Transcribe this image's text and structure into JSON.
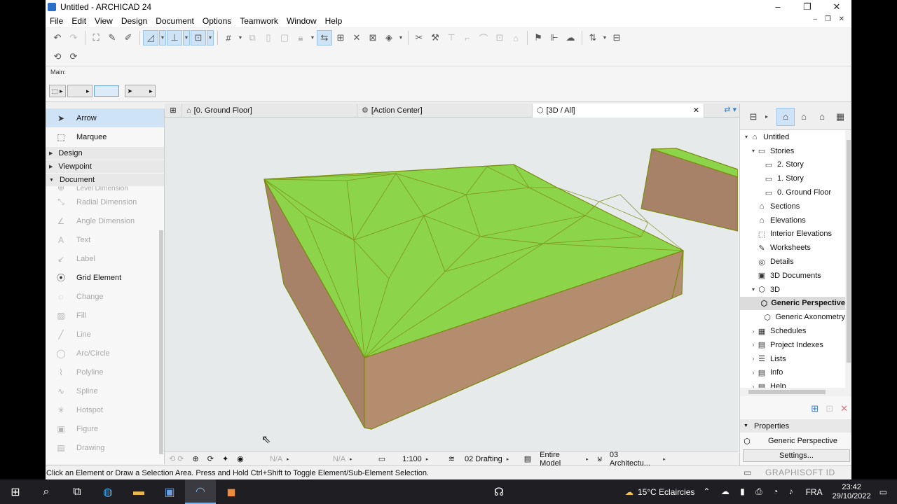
{
  "window": {
    "title": "Untitled - ARCHICAD 24",
    "controls": [
      "–",
      "❐",
      "✕"
    ]
  },
  "menu": [
    "File",
    "Edit",
    "View",
    "Design",
    "Document",
    "Options",
    "Teamwork",
    "Window",
    "Help"
  ],
  "infobox": {
    "label": "Main:"
  },
  "toolbox": {
    "arrow": "Arrow",
    "marquee": "Marquee",
    "groups": {
      "design": "Design",
      "viewpoint": "Viewpoint",
      "document": "Document"
    },
    "partial_item": "Level Dimension",
    "tools": [
      {
        "label": "Radial Dimension",
        "icon": "radial-dimension-icon",
        "glyph": "⤡",
        "enabled": false
      },
      {
        "label": "Angle Dimension",
        "icon": "angle-dimension-icon",
        "glyph": "∠",
        "enabled": false
      },
      {
        "label": "Text",
        "icon": "text-icon",
        "glyph": "A",
        "enabled": false
      },
      {
        "label": "Label",
        "icon": "label-icon",
        "glyph": "↙",
        "enabled": false
      },
      {
        "label": "Grid Element",
        "icon": "grid-element-icon",
        "glyph": "⦿",
        "enabled": true
      },
      {
        "label": "Change",
        "icon": "change-icon",
        "glyph": "◌",
        "enabled": false
      },
      {
        "label": "Fill",
        "icon": "fill-icon",
        "glyph": "▨",
        "enabled": false
      },
      {
        "label": "Line",
        "icon": "line-icon",
        "glyph": "╱",
        "enabled": false
      },
      {
        "label": "Arc/Circle",
        "icon": "arc-circle-icon",
        "glyph": "◯",
        "enabled": false
      },
      {
        "label": "Polyline",
        "icon": "polyline-icon",
        "glyph": "⌇",
        "enabled": false
      },
      {
        "label": "Spline",
        "icon": "spline-icon",
        "glyph": "∿",
        "enabled": false
      },
      {
        "label": "Hotspot",
        "icon": "hotspot-icon",
        "glyph": "✳",
        "enabled": false
      },
      {
        "label": "Figure",
        "icon": "figure-icon",
        "glyph": "▣",
        "enabled": false
      },
      {
        "label": "Drawing",
        "icon": "drawing-icon",
        "glyph": "▤",
        "enabled": false
      }
    ]
  },
  "tabs": [
    {
      "label": "[0. Ground Floor]",
      "icon": "floor-plan-icon",
      "glyph": "⌂"
    },
    {
      "label": "[Action Center]",
      "icon": "action-center-icon",
      "glyph": "⚙"
    },
    {
      "label": "[3D / All]",
      "icon": "3d-view-icon",
      "glyph": "⬡"
    }
  ],
  "view_status": {
    "nav_a": "N/A",
    "nav_b": "N/A",
    "scale": "1:100",
    "layer_combo": "02 Drafting",
    "model_view": "Entire Model",
    "renovation": "03 Architectu..."
  },
  "status_message": "Click an Element or Draw a Selection Area. Press and Hold Ctrl+Shift to Toggle Element/Sub-Element Selection.",
  "brand": "GRAPHISOFT ID",
  "navigator": {
    "items": [
      {
        "label": "Untitled",
        "indent": 0,
        "caret": "▾",
        "icon": "project-icon",
        "glyph": "⌂",
        "selected": false
      },
      {
        "label": "Stories",
        "indent": 1,
        "caret": "▾",
        "icon": "stories-icon",
        "glyph": "▭",
        "selected": false
      },
      {
        "label": "2. Story",
        "indent": 2,
        "caret": "",
        "icon": "story-icon",
        "glyph": "▭",
        "selected": false
      },
      {
        "label": "1. Story",
        "indent": 2,
        "caret": "",
        "icon": "story-icon",
        "glyph": "▭",
        "selected": false
      },
      {
        "label": "0. Ground Floor",
        "indent": 2,
        "caret": "",
        "icon": "story-icon",
        "glyph": "▭",
        "selected": false
      },
      {
        "label": "Sections",
        "indent": 1,
        "caret": "",
        "icon": "sections-icon",
        "glyph": "⌂",
        "selected": false
      },
      {
        "label": "Elevations",
        "indent": 1,
        "caret": "",
        "icon": "elevations-icon",
        "glyph": "⌂",
        "selected": false
      },
      {
        "label": "Interior Elevations",
        "indent": 1,
        "caret": "",
        "icon": "interior-elevations-icon",
        "glyph": "⬚",
        "selected": false
      },
      {
        "label": "Worksheets",
        "indent": 1,
        "caret": "",
        "icon": "worksheets-icon",
        "glyph": "✎",
        "selected": false
      },
      {
        "label": "Details",
        "indent": 1,
        "caret": "",
        "icon": "details-icon",
        "glyph": "◎",
        "selected": false
      },
      {
        "label": "3D Documents",
        "indent": 1,
        "caret": "",
        "icon": "3d-documents-icon",
        "glyph": "▣",
        "selected": false
      },
      {
        "label": "3D",
        "indent": 1,
        "caret": "▾",
        "icon": "3d-icon",
        "glyph": "⬡",
        "selected": false
      },
      {
        "label": "Generic Perspective",
        "indent": 2,
        "caret": "",
        "icon": "perspective-icon",
        "glyph": "⬡",
        "selected": true
      },
      {
        "label": "Generic Axonometry",
        "indent": 2,
        "caret": "",
        "icon": "axonometry-icon",
        "glyph": "⬡",
        "selected": false
      },
      {
        "label": "Schedules",
        "indent": 1,
        "caret": "›",
        "icon": "schedules-icon",
        "glyph": "▦",
        "selected": false
      },
      {
        "label": "Project Indexes",
        "indent": 1,
        "caret": "›",
        "icon": "project-indexes-icon",
        "glyph": "▤",
        "selected": false
      },
      {
        "label": "Lists",
        "indent": 1,
        "caret": "›",
        "icon": "lists-icon",
        "glyph": "☰",
        "selected": false
      },
      {
        "label": "Info",
        "indent": 1,
        "caret": "›",
        "icon": "info-icon",
        "glyph": "▤",
        "selected": false
      },
      {
        "label": "Help",
        "indent": 1,
        "caret": "›",
        "icon": "help-icon",
        "glyph": "▤",
        "selected": false
      }
    ],
    "properties_header": "Properties",
    "properties_name": "Generic Perspective",
    "settings_label": "Settings..."
  },
  "taskbar": {
    "weather": "15°C  Eclaircies",
    "language": "FRA",
    "time": "23:42",
    "date": "29/10/2022"
  },
  "colors": {
    "terrain_top": "#8cd44a",
    "terrain_side": "#b48c6e",
    "edge": "#7a8a10",
    "selection": "#cfe3f7",
    "viewport_bg": "#e6eaea"
  }
}
